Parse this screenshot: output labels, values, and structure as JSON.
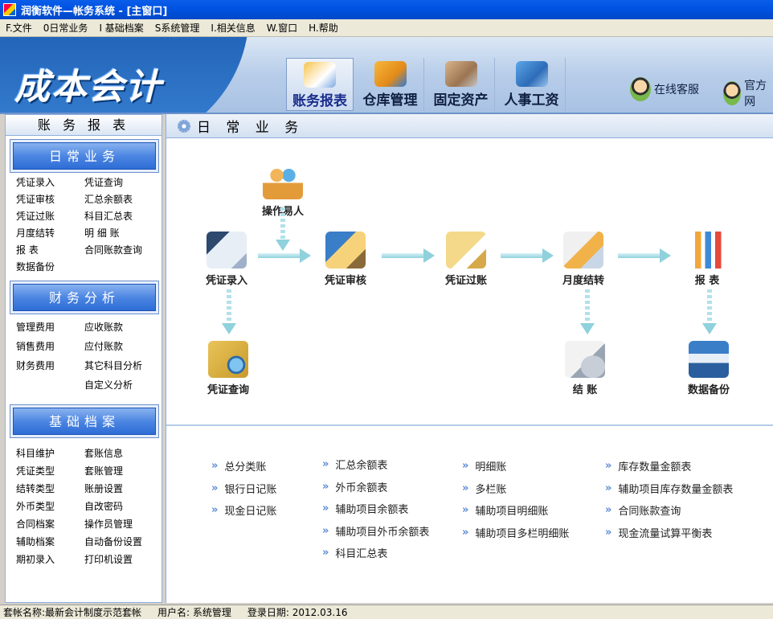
{
  "window": {
    "title": "润衡软件—帐务系统 - [主窗口]"
  },
  "menu": [
    "F.文件",
    "0日常业务",
    "I 基础档案",
    "S系统管理",
    "I.相关信息",
    "W.窗口",
    "H.帮助"
  ],
  "banner": {
    "logo": "成本会计",
    "nav": [
      {
        "label": "账务报表",
        "icon": "money-bag-pen-icon"
      },
      {
        "label": "仓库管理",
        "icon": "box-chart-icon"
      },
      {
        "label": "固定资产",
        "icon": "tools-icon"
      },
      {
        "label": "人事工资",
        "icon": "people-icon"
      }
    ],
    "services": [
      "在线客服",
      "官方网"
    ]
  },
  "sidebar": {
    "title": "账 务 报 表",
    "sections": [
      {
        "title": "日常业务",
        "items": [
          "凭证录入",
          "凭证查询",
          "凭证审核",
          "汇总余额表",
          "凭证过账",
          "科目汇总表",
          "月度结转",
          "明 细 账",
          "报 表",
          "合同账款查询",
          "数据备份",
          ""
        ]
      },
      {
        "title": "财务分析",
        "items": [
          "管理费用",
          "应收账款",
          "销售费用",
          "应付账款",
          "财务费用",
          "其它科目分析",
          "",
          "自定义分析"
        ]
      },
      {
        "title": "基础档案",
        "items": [
          "科目维护",
          "套账信息",
          "凭证类型",
          "套账管理",
          "结转类型",
          "账册设置",
          "外币类型",
          "自改密码",
          "合同档案",
          "操作员管理",
          "辅助档案",
          "自动备份设置",
          "期初录入",
          "打印机设置"
        ]
      }
    ]
  },
  "main": {
    "title": "日 常 业 务",
    "flow": {
      "operator": "操作易人",
      "entry": "凭证录入",
      "audit": "凭证审核",
      "post": "凭证过账",
      "monthly": "月度结转",
      "report": "报  表",
      "query": "凭证查询",
      "close": "结  账",
      "backup": "数据备份"
    },
    "reports": [
      [
        "总分类账",
        "银行日记账",
        "现金日记账"
      ],
      [
        "汇总余额表",
        "外币余额表",
        "辅助项目余额表",
        "辅助项目外币余额表",
        "科目汇总表"
      ],
      [
        "明细账",
        "多栏账",
        "辅助项目明细账",
        "辅助项目多栏明细账"
      ],
      [
        "库存数量金额表",
        "辅助项目库存数量金额表",
        "合同账款查询",
        "现金流量试算平衡表"
      ]
    ]
  },
  "status": {
    "set": "套帐名称:最新会计制度示范套帐",
    "user": "用户名: 系统管理",
    "date": "登录日期: 2012.03.16"
  }
}
